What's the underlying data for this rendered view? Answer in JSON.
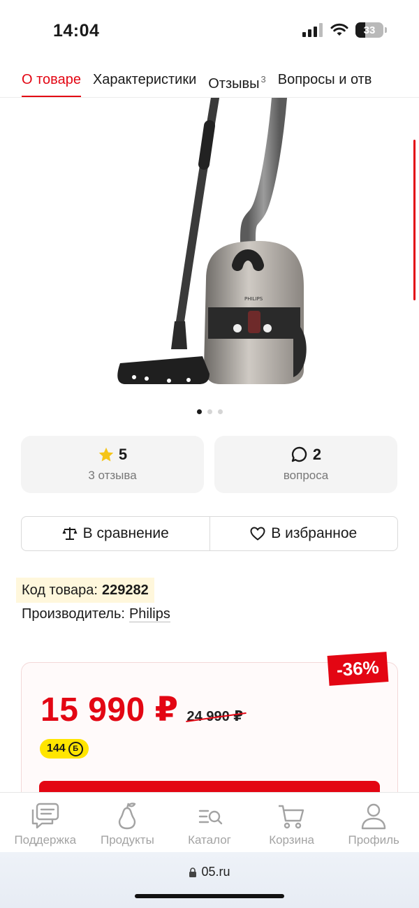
{
  "status_bar": {
    "time": "14:04",
    "battery": "33"
  },
  "tabs": [
    {
      "label": "О товаре",
      "active": true
    },
    {
      "label": "Характеристики",
      "active": false
    },
    {
      "label": "Отзывы",
      "badge": "3",
      "active": false
    },
    {
      "label": "Вопросы и отв",
      "active": false
    }
  ],
  "product": {
    "image_icon": "vacuum-cleaner-image",
    "brand_mark": "PHILIPS",
    "gallery_count": 3,
    "gallery_active": 0
  },
  "rating": {
    "value": "5",
    "label": "3 отзыва"
  },
  "questions": {
    "value": "2",
    "label": "вопроса"
  },
  "actions": {
    "compare": "В сравнение",
    "favorite": "В избранное"
  },
  "info": {
    "code_label": "Код товара:",
    "code_value": "229282",
    "maker_label": "Производитель:",
    "maker_value": "Philips"
  },
  "price": {
    "discount": "-36%",
    "current": "15 990 ₽",
    "old": "24 990 ₽",
    "bonus": "144",
    "bonus_symbol": "Б"
  },
  "bottom_nav": [
    {
      "label": "Поддержка",
      "icon": "chat-icon"
    },
    {
      "label": "Продукты",
      "icon": "pear-icon"
    },
    {
      "label": "Каталог",
      "icon": "catalog-search-icon"
    },
    {
      "label": "Корзина",
      "icon": "cart-icon"
    },
    {
      "label": "Профиль",
      "icon": "profile-icon"
    }
  ],
  "browser": {
    "url": "05.ru"
  },
  "colors": {
    "accent": "#e30613",
    "bonus": "#ffe500",
    "star": "#f5c518"
  }
}
